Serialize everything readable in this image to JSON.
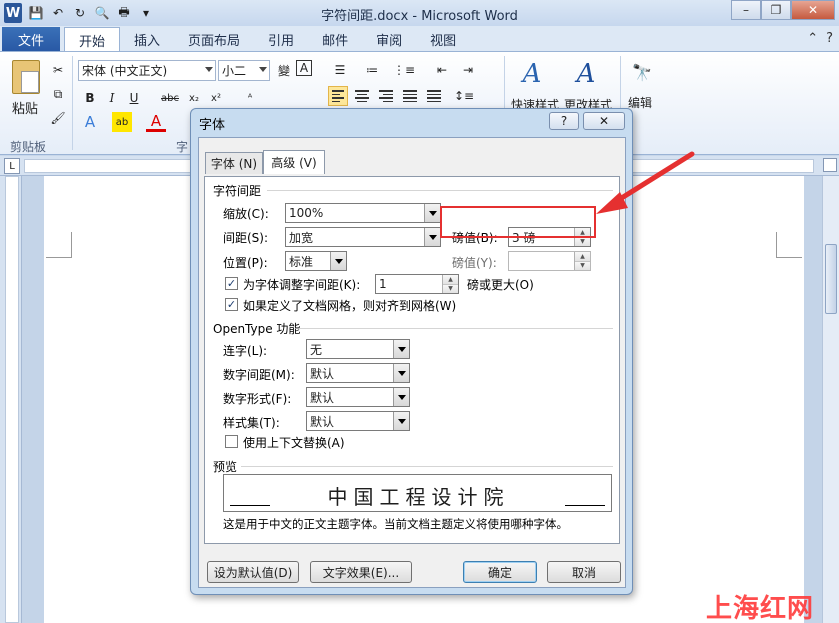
{
  "app": {
    "window_title": "字符间距.docx - Microsoft Word"
  },
  "ribbon": {
    "file_tab": "文件",
    "tabs": [
      {
        "label": "开始",
        "active": true
      },
      {
        "label": "插入"
      },
      {
        "label": "页面布局"
      },
      {
        "label": "引用"
      },
      {
        "label": "邮件"
      },
      {
        "label": "审阅"
      },
      {
        "label": "视图"
      }
    ],
    "paste_label": "粘贴",
    "clipboard_label": "剪贴板",
    "font_group_label": "字",
    "font_name": "宋体 (中文正文)",
    "font_size": "小二",
    "quick_styles_label": "快速样式",
    "change_styles_label": "更改样式",
    "edit_label": "编辑"
  },
  "dialog": {
    "title": "字体",
    "help_label": "?",
    "close_label": "✕",
    "tabs": {
      "font": "字体 (N)",
      "advanced": "高级 (V)"
    },
    "char_spacing": {
      "section_title": "字符间距",
      "scale_label": "缩放(C):",
      "scale_value": "100%",
      "spacing_label": "间距(S):",
      "spacing_value": "加宽",
      "spacing_pt_label": "磅值(B):",
      "spacing_pt_value": "3 磅",
      "position_label": "位置(P):",
      "position_value": "标准",
      "position_pt_label": "磅值(Y):",
      "position_pt_value": "",
      "kerning_label": "为字体调整字间距(K):",
      "kerning_checked": true,
      "kerning_value": "1",
      "kerning_suffix": "磅或更大(O)",
      "grid_label": "如果定义了文档网格，则对齐到网格(W)",
      "grid_checked": true
    },
    "opentype": {
      "section_title": "OpenType 功能",
      "ligatures_label": "连字(L):",
      "ligatures_value": "无",
      "num_spacing_label": "数字间距(M):",
      "num_spacing_value": "默认",
      "num_forms_label": "数字形式(F):",
      "num_forms_value": "默认",
      "stylistic_label": "样式集(T):",
      "stylistic_value": "默认",
      "contextual_label": "使用上下文替换(A)",
      "contextual_checked": false
    },
    "preview": {
      "section_title": "预览",
      "sample_text": "中国工程设计院",
      "note": "这是用于中文的正文主题字体。当前文档主题定义将使用哪种字体。"
    },
    "buttons": {
      "set_default": "设为默认值(D)",
      "text_effects": "文字效果(E)...",
      "ok": "确定",
      "cancel": "取消"
    }
  },
  "watermark": "上海红网",
  "colors": {
    "highlight": "#e53030",
    "word_blue": "#2b579a"
  }
}
